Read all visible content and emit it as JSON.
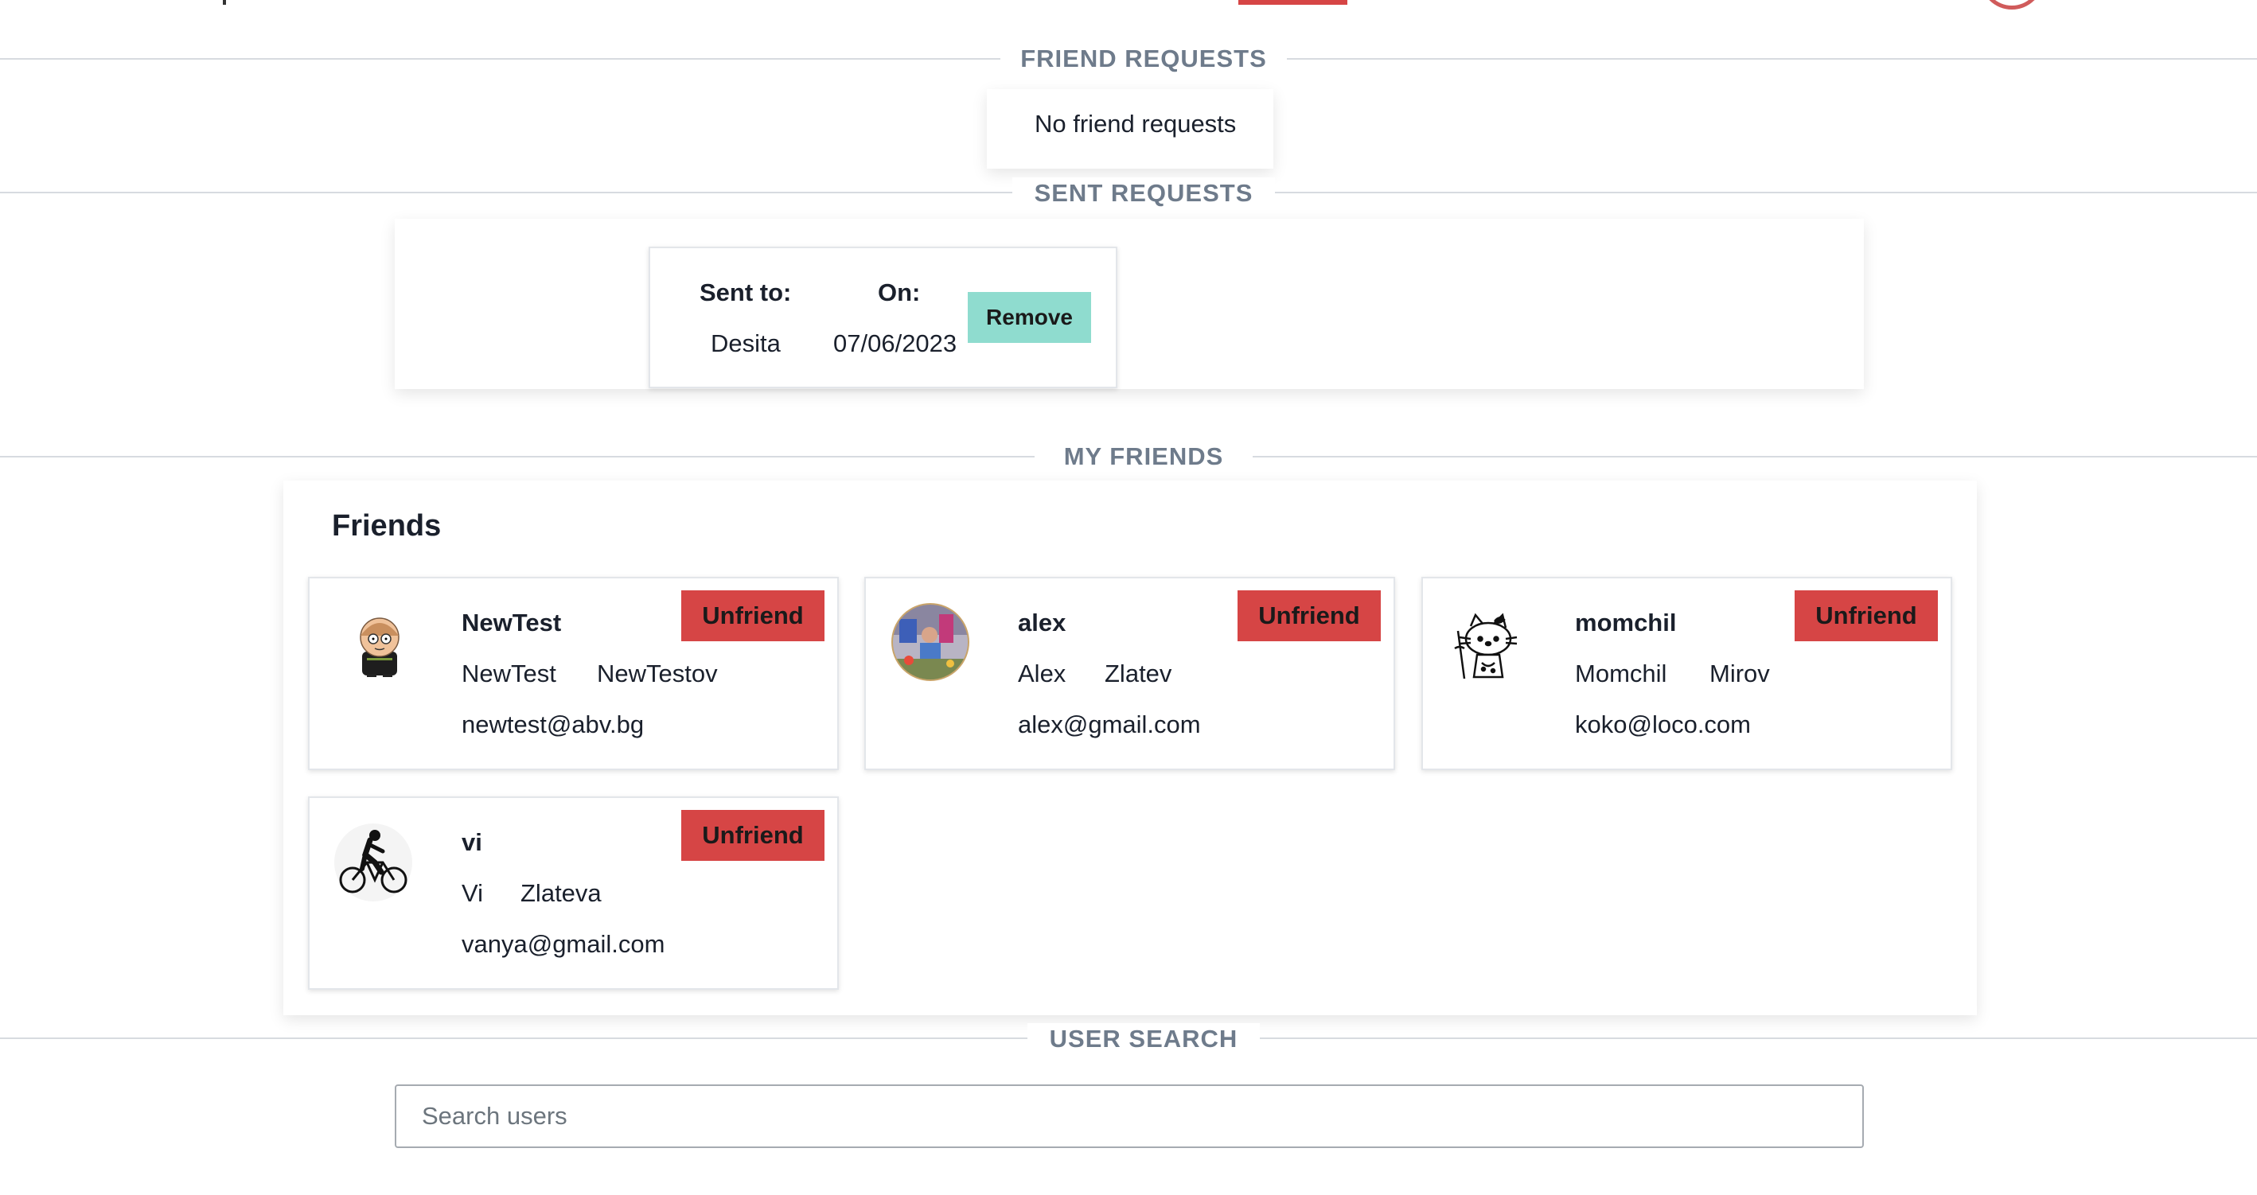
{
  "colors": {
    "accent_red": "#d64545",
    "accent_teal": "#8fdccf",
    "label_gray": "#6e7b8b",
    "divider": "#d7dbe0"
  },
  "sections": {
    "friend_requests": "FRIEND REQUESTS",
    "sent_requests": "SENT REQUESTS",
    "my_friends": "MY FRIENDS",
    "user_search": "USER SEARCH"
  },
  "friend_requests": {
    "empty_text": "No friend requests"
  },
  "sent_requests": {
    "sent_to_header": "Sent to:",
    "on_header": "On:",
    "items": [
      {
        "name": "Desita",
        "date": "07/06/2023",
        "action": "Remove"
      }
    ]
  },
  "friends": {
    "title": "Friends",
    "items": [
      {
        "username": "NewTest",
        "first_name": "NewTest",
        "last_name": "NewTestov",
        "email": "newtest@abv.bg",
        "action": "Unfriend",
        "avatar": "cartoon-character-avatar"
      },
      {
        "username": "alex",
        "first_name": "Alex",
        "last_name": "Zlatev",
        "email": "alex@gmail.com",
        "action": "Unfriend",
        "avatar": "photo-avatar"
      },
      {
        "username": "momchil",
        "first_name": "Momchil",
        "last_name": "Mirov",
        "email": "koko@loco.com",
        "action": "Unfriend",
        "avatar": "hello-kitty-avatar"
      },
      {
        "username": "vi",
        "first_name": "Vi",
        "last_name": "Zlateva",
        "email": "vanya@gmail.com",
        "action": "Unfriend",
        "avatar": "cyclist-avatar"
      }
    ]
  },
  "search": {
    "placeholder": "Search users",
    "value": ""
  }
}
